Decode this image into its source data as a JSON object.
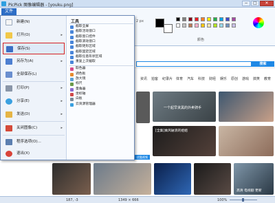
{
  "window": {
    "title": "PicPick 图像编辑器 - [youku.png]",
    "controls": {
      "minimize": "−",
      "maximize": "□",
      "close": "✕"
    }
  },
  "ribbon": {
    "file_tab": "文件",
    "zoom_text": "2 px",
    "colors_label": "颜色",
    "colors": [
      "#000000",
      "#7f7f7f",
      "#880015",
      "#ed1c24",
      "#ff7f27",
      "#fff200",
      "#22b14c",
      "#00a2e8",
      "#3f48cc",
      "#a349a4",
      "#ffffff",
      "#c3c3c3",
      "#b97a57",
      "#ffaec9",
      "#ffc90e",
      "#efe4b0",
      "#b5e61d",
      "#99d9ea",
      "#7092be",
      "#c8bfe7"
    ]
  },
  "file_menu": {
    "items": [
      {
        "label": "新建(N)",
        "icon": "new-file-icon",
        "arrow": ""
      },
      {
        "label": "打开(O)",
        "icon": "open-folder-icon",
        "arrow": "▸"
      },
      {
        "label": "保存(S)",
        "icon": "save-icon",
        "arrow": ""
      },
      {
        "label": "另存为(A)",
        "icon": "save-as-icon",
        "arrow": "▸"
      },
      {
        "label": "全部保存(L)",
        "icon": "save-all-icon",
        "arrow": ""
      },
      {
        "label": "打印(P)",
        "icon": "print-icon",
        "arrow": "▸"
      },
      {
        "label": "分享(E)",
        "icon": "share-icon",
        "arrow": "▸"
      },
      {
        "label": "发送(D)",
        "icon": "send-icon",
        "arrow": "▸"
      },
      {
        "label": "关闭图像(C)",
        "icon": "close-image-icon",
        "arrow": "▸"
      },
      {
        "label": "程序选项(O)...",
        "icon": "options-icon",
        "arrow": ""
      },
      {
        "label": "退出(X)",
        "icon": "exit-icon",
        "arrow": ""
      }
    ],
    "tools_title": "工具",
    "tools": [
      {
        "label": "截取全屏",
        "icon": "fullscreen-capture-icon"
      },
      {
        "label": "截取活动窗口",
        "icon": "active-window-capture-icon"
      },
      {
        "label": "截取窗口控件",
        "icon": "window-control-capture-icon"
      },
      {
        "label": "截取滚动窗口",
        "icon": "scroll-capture-icon"
      },
      {
        "label": "截取矩形区域",
        "icon": "rect-capture-icon"
      },
      {
        "label": "截取固定区域",
        "icon": "fixed-region-capture-icon"
      },
      {
        "label": "截取任意形状区域",
        "icon": "freehand-capture-icon"
      },
      {
        "label": "重复上次截取",
        "icon": "repeat-capture-icon"
      },
      {
        "label": "取色器",
        "icon": "color-picker-icon"
      },
      {
        "label": "调色板",
        "icon": "color-palette-icon"
      },
      {
        "label": "放大镜",
        "icon": "magnifier-icon"
      },
      {
        "label": "标尺",
        "icon": "ruler-icon"
      },
      {
        "label": "量角器",
        "icon": "protractor-icon"
      },
      {
        "label": "坐标轴",
        "icon": "crosshair-icon"
      },
      {
        "label": "白板",
        "icon": "whiteboard-icon"
      },
      {
        "label": "云资源管理器",
        "icon": "cloud-explorer-icon"
      }
    ]
  },
  "web": {
    "search_button": "搜索",
    "nav": [
      "资讯",
      "拍客",
      "纪录片",
      "体育",
      "汽车",
      "科技",
      "财经",
      "娱乐",
      "原创",
      "游戏",
      "搞笑",
      "教育"
    ],
    "captions": {
      "video1": "一个起早贪黑的外卖骑手",
      "video2": "[全集]乘风破浪的姐姐",
      "video3": "高清 电视剧 更新",
      "blue_tag": "优酷视频"
    }
  },
  "status": {
    "cursor": "187, -3",
    "size": "1349 × 666",
    "zoom": "100%"
  }
}
